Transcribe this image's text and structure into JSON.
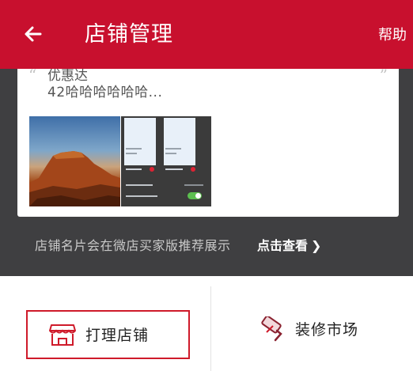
{
  "header": {
    "title": "店铺管理",
    "help_label": "帮助",
    "back_icon": "arrow-left-icon",
    "background": "#c8102e"
  },
  "card": {
    "name": "优惠达",
    "description": "42哈哈哈哈哈哈...",
    "quote_open": "“",
    "quote_close": "”"
  },
  "info": {
    "text": "店铺名片会在微店买家版推荐展示",
    "link_label": "点击查看",
    "link_chevron": "❯"
  },
  "actions": {
    "manage_label": "打理店铺",
    "manage_icon": "storefront-icon",
    "decorate_label": "装修市场",
    "decorate_icon": "paint-roller-icon",
    "accent": "#cf1a2a"
  }
}
